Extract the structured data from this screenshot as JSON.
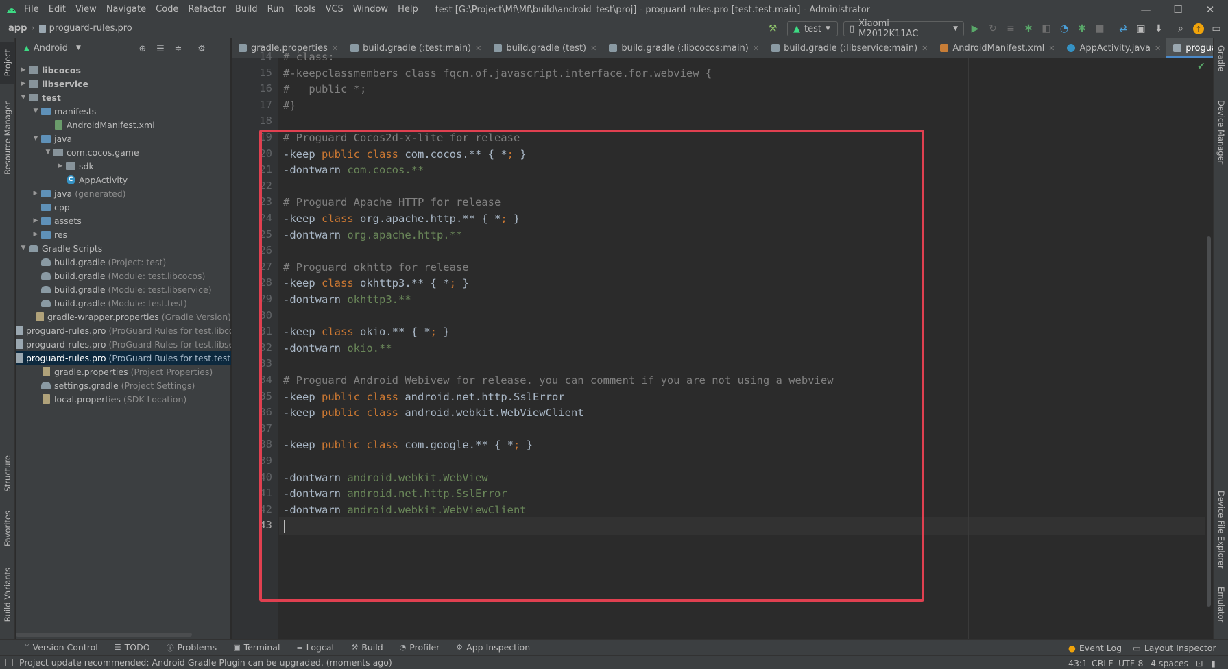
{
  "window": {
    "title": "test [G:\\Project\\Mf\\Mf\\build\\android_test\\proj] - proguard-rules.pro [test.test.main] - Administrator",
    "minimize": "—",
    "maximize": "☐",
    "close": "✕"
  },
  "menu": [
    "File",
    "Edit",
    "View",
    "Navigate",
    "Code",
    "Refactor",
    "Build",
    "Run",
    "Tools",
    "VCS",
    "Window",
    "Help"
  ],
  "navbar": {
    "app": "app",
    "file": "proguard-rules.pro",
    "run_config": "test",
    "device": "Xiaomi M2012K11AC"
  },
  "project_panel": {
    "view": "Android",
    "tree": [
      {
        "label": "libcocos",
        "hint": "",
        "depth": 0,
        "arrow": "right",
        "icon": "module-folder",
        "bold": true
      },
      {
        "label": "libservice",
        "hint": "",
        "depth": 0,
        "arrow": "right",
        "icon": "module-folder",
        "bold": true
      },
      {
        "label": "test",
        "hint": "",
        "depth": 0,
        "arrow": "down",
        "icon": "module-folder",
        "bold": true
      },
      {
        "label": "manifests",
        "hint": "",
        "depth": 1,
        "arrow": "down",
        "icon": "folder-blue"
      },
      {
        "label": "AndroidManifest.xml",
        "hint": "",
        "depth": 2,
        "arrow": "",
        "icon": "manifest-file"
      },
      {
        "label": "java",
        "hint": "",
        "depth": 1,
        "arrow": "down",
        "icon": "folder-blue"
      },
      {
        "label": "com.cocos.game",
        "hint": "",
        "depth": 2,
        "arrow": "down",
        "icon": "package"
      },
      {
        "label": "sdk",
        "hint": "",
        "depth": 3,
        "arrow": "right",
        "icon": "package"
      },
      {
        "label": "AppActivity",
        "hint": "",
        "depth": 3,
        "arrow": "",
        "icon": "class"
      },
      {
        "label": "java",
        "hint": "(generated)",
        "depth": 1,
        "arrow": "right",
        "icon": "folder-blue"
      },
      {
        "label": "cpp",
        "hint": "",
        "depth": 1,
        "arrow": "",
        "icon": "folder-blue"
      },
      {
        "label": "assets",
        "hint": "",
        "depth": 1,
        "arrow": "right",
        "icon": "folder-blue"
      },
      {
        "label": "res",
        "hint": "",
        "depth": 1,
        "arrow": "right",
        "icon": "folder-blue"
      },
      {
        "label": "Gradle Scripts",
        "hint": "",
        "depth": 0,
        "arrow": "down",
        "icon": "gradle"
      },
      {
        "label": "build.gradle",
        "hint": "(Project: test)",
        "depth": 1,
        "arrow": "",
        "icon": "gradle"
      },
      {
        "label": "build.gradle",
        "hint": "(Module: test.libcocos)",
        "depth": 1,
        "arrow": "",
        "icon": "gradle"
      },
      {
        "label": "build.gradle",
        "hint": "(Module: test.libservice)",
        "depth": 1,
        "arrow": "",
        "icon": "gradle"
      },
      {
        "label": "build.gradle",
        "hint": "(Module: test.test)",
        "depth": 1,
        "arrow": "",
        "icon": "gradle"
      },
      {
        "label": "gradle-wrapper.properties",
        "hint": "(Gradle Version)",
        "depth": 1,
        "arrow": "",
        "icon": "properties-file"
      },
      {
        "label": "proguard-rules.pro",
        "hint": "(ProGuard Rules for test.libcocos)",
        "depth": 1,
        "arrow": "",
        "icon": "file"
      },
      {
        "label": "proguard-rules.pro",
        "hint": "(ProGuard Rules for test.libservice)",
        "depth": 1,
        "arrow": "",
        "icon": "file"
      },
      {
        "label": "proguard-rules.pro",
        "hint": "(ProGuard Rules for test.test)",
        "depth": 1,
        "arrow": "",
        "icon": "file",
        "selected": true
      },
      {
        "label": "gradle.properties",
        "hint": "(Project Properties)",
        "depth": 1,
        "arrow": "",
        "icon": "properties-file"
      },
      {
        "label": "settings.gradle",
        "hint": "(Project Settings)",
        "depth": 1,
        "arrow": "",
        "icon": "gradle"
      },
      {
        "label": "local.properties",
        "hint": "(SDK Location)",
        "depth": 1,
        "arrow": "",
        "icon": "properties-file"
      }
    ]
  },
  "editor_tabs": [
    {
      "label": "gradle.properties",
      "icon": "properties",
      "active": false
    },
    {
      "label": "build.gradle (:test:main)",
      "icon": "gradle",
      "active": false
    },
    {
      "label": "build.gradle (test)",
      "icon": "gradle",
      "active": false
    },
    {
      "label": "build.gradle (:libcocos:main)",
      "icon": "gradle",
      "active": false
    },
    {
      "label": "build.gradle (:libservice:main)",
      "icon": "gradle",
      "active": false
    },
    {
      "label": "AndroidManifest.xml",
      "icon": "xml",
      "active": false
    },
    {
      "label": "AppActivity.java",
      "icon": "java",
      "active": false
    },
    {
      "label": "proguard-rules.pro",
      "icon": "pro",
      "active": true
    }
  ],
  "code": [
    {
      "n": 14,
      "tokens": [
        [
          "c",
          "# class:"
        ]
      ]
    },
    {
      "n": 15,
      "tokens": [
        [
          "c",
          "#-keepclassmembers class fqcn.of.javascript.interface.for.webview {"
        ]
      ]
    },
    {
      "n": 16,
      "tokens": [
        [
          "c",
          "#   public *;"
        ]
      ]
    },
    {
      "n": 17,
      "tokens": [
        [
          "c",
          "#}"
        ]
      ]
    },
    {
      "n": 18,
      "tokens": []
    },
    {
      "n": 19,
      "tokens": [
        [
          "c",
          "# Proguard Cocos2d-x-lite for release"
        ]
      ]
    },
    {
      "n": 20,
      "tokens": [
        [
          "p",
          "-keep "
        ],
        [
          "k",
          "public"
        ],
        [
          "p",
          " "
        ],
        [
          "k",
          "class"
        ],
        [
          "p",
          " com.cocos.** { *"
        ],
        [
          "k",
          ";"
        ],
        [
          "p",
          " }"
        ]
      ]
    },
    {
      "n": 21,
      "tokens": [
        [
          "p",
          "-dontwarn "
        ],
        [
          "s",
          "com.cocos.**"
        ]
      ]
    },
    {
      "n": 22,
      "tokens": []
    },
    {
      "n": 23,
      "tokens": [
        [
          "c",
          "# Proguard Apache HTTP for release"
        ]
      ]
    },
    {
      "n": 24,
      "tokens": [
        [
          "p",
          "-keep "
        ],
        [
          "k",
          "class"
        ],
        [
          "p",
          " org.apache.http.** { *"
        ],
        [
          "k",
          ";"
        ],
        [
          "p",
          " }"
        ]
      ]
    },
    {
      "n": 25,
      "tokens": [
        [
          "p",
          "-dontwarn "
        ],
        [
          "s",
          "org.apache.http.**"
        ]
      ]
    },
    {
      "n": 26,
      "tokens": []
    },
    {
      "n": 27,
      "tokens": [
        [
          "c",
          "# Proguard okhttp for release"
        ]
      ]
    },
    {
      "n": 28,
      "tokens": [
        [
          "p",
          "-keep "
        ],
        [
          "k",
          "class"
        ],
        [
          "p",
          " okhttp3.** { *"
        ],
        [
          "k",
          ";"
        ],
        [
          "p",
          " }"
        ]
      ]
    },
    {
      "n": 29,
      "tokens": [
        [
          "p",
          "-dontwarn "
        ],
        [
          "s",
          "okhttp3.**"
        ]
      ]
    },
    {
      "n": 30,
      "tokens": []
    },
    {
      "n": 31,
      "tokens": [
        [
          "p",
          "-keep "
        ],
        [
          "k",
          "class"
        ],
        [
          "p",
          " okio.** { *"
        ],
        [
          "k",
          ";"
        ],
        [
          "p",
          " }"
        ]
      ]
    },
    {
      "n": 32,
      "tokens": [
        [
          "p",
          "-dontwarn "
        ],
        [
          "s",
          "okio.**"
        ]
      ]
    },
    {
      "n": 33,
      "tokens": []
    },
    {
      "n": 34,
      "tokens": [
        [
          "c",
          "# Proguard Android Webivew for release. you can comment if you are not using a webview"
        ]
      ]
    },
    {
      "n": 35,
      "tokens": [
        [
          "p",
          "-keep "
        ],
        [
          "k",
          "public"
        ],
        [
          "p",
          " "
        ],
        [
          "k",
          "class"
        ],
        [
          "p",
          " android.net.http.SslError"
        ]
      ]
    },
    {
      "n": 36,
      "tokens": [
        [
          "p",
          "-keep "
        ],
        [
          "k",
          "public"
        ],
        [
          "p",
          " "
        ],
        [
          "k",
          "class"
        ],
        [
          "p",
          " android.webkit.WebViewClient"
        ]
      ]
    },
    {
      "n": 37,
      "tokens": []
    },
    {
      "n": 38,
      "tokens": [
        [
          "p",
          "-keep "
        ],
        [
          "k",
          "public"
        ],
        [
          "p",
          " "
        ],
        [
          "k",
          "class"
        ],
        [
          "p",
          " com.google.** { *"
        ],
        [
          "k",
          ";"
        ],
        [
          "p",
          " }"
        ]
      ]
    },
    {
      "n": 39,
      "tokens": []
    },
    {
      "n": 40,
      "tokens": [
        [
          "p",
          "-dontwarn "
        ],
        [
          "s",
          "android.webkit.WebView"
        ]
      ]
    },
    {
      "n": 41,
      "tokens": [
        [
          "p",
          "-dontwarn "
        ],
        [
          "s",
          "android.net.http.SslError"
        ]
      ]
    },
    {
      "n": 42,
      "tokens": [
        [
          "p",
          "-dontwarn "
        ],
        [
          "s",
          "android.webkit.WebViewClient"
        ]
      ]
    },
    {
      "n": 43,
      "tokens": [],
      "current": true
    }
  ],
  "left_strip": [
    "Project",
    "Resource Manager",
    "Structure",
    "Favorites",
    "Build Variants"
  ],
  "right_strip": [
    "Gradle",
    "Device Manager",
    "Device File Explorer",
    "Emulator"
  ],
  "bottom_tools": [
    "Version Control",
    "TODO",
    "Problems",
    "Terminal",
    "Logcat",
    "Build",
    "Profiler",
    "App Inspection"
  ],
  "bottom_right": [
    "Event Log",
    "Layout Inspector"
  ],
  "status": {
    "message": "Project update recommended: Android Gradle Plugin can be upgraded. (moments ago)",
    "position": "43:1",
    "line_sep": "CRLF",
    "encoding": "UTF-8",
    "indent": "4 spaces"
  },
  "colors": {
    "highlight_border": "#e04050",
    "comment": "#808080",
    "keyword": "#cc7832",
    "string": "#6a8759",
    "plain": "#a9b7c6"
  }
}
